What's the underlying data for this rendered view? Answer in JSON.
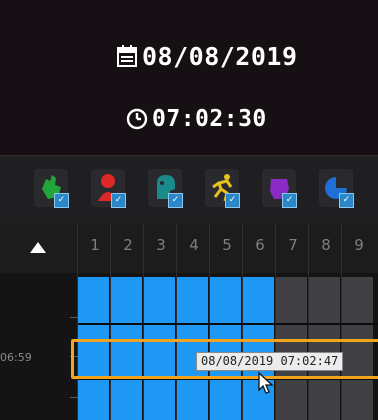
{
  "header": {
    "date": "08/08/2019",
    "time": "07:02:30",
    "calendar_icon": "calendar-icon",
    "clock_icon": "clock-icon"
  },
  "event_filters": [
    {
      "name": "motion",
      "icon": "motion-hand-icon",
      "color": "#22a63a",
      "checked": true
    },
    {
      "name": "alarm",
      "icon": "alarm-person-icon",
      "color": "#e02727",
      "checked": true
    },
    {
      "name": "face",
      "icon": "face-head-icon",
      "color": "#1a8a8a",
      "checked": true
    },
    {
      "name": "intrusion",
      "icon": "running-person-icon",
      "color": "#e6c21a",
      "checked": true
    },
    {
      "name": "object",
      "icon": "purple-object-icon",
      "color": "#8a2bc6",
      "checked": true
    },
    {
      "name": "tracking",
      "icon": "blue-pie-icon",
      "color": "#1e6fd6",
      "checked": true
    }
  ],
  "timeline": {
    "channels": [
      "1",
      "2",
      "3",
      "4",
      "5",
      "6",
      "7",
      "8",
      "9"
    ],
    "recorded": [
      true,
      true,
      true,
      true,
      true,
      true,
      false,
      false,
      false
    ],
    "time_label": "06:59",
    "tooltip": "08/08/2019 07:02:47"
  },
  "colors": {
    "accent_selection": "#f3a41d",
    "recording": "#1e98f4",
    "empty_channel": "#404045"
  }
}
